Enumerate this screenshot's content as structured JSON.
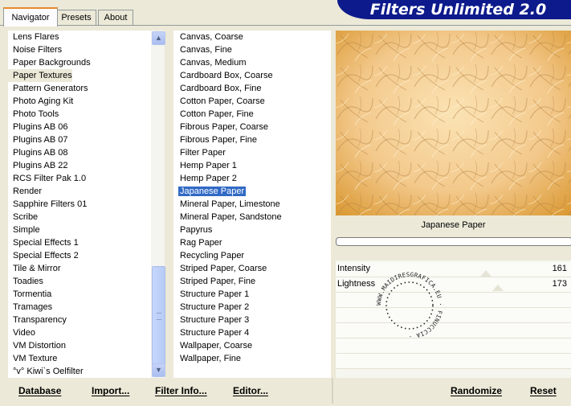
{
  "tabs": [
    {
      "label": "Navigator",
      "active": true
    },
    {
      "label": "Presets",
      "active": false
    },
    {
      "label": "About",
      "active": false
    }
  ],
  "banner_title": "Filters Unlimited 2.0",
  "categories": [
    "Lens Flares",
    "Noise Filters",
    "Paper Backgrounds",
    "Paper Textures",
    "Pattern Generators",
    "Photo Aging Kit",
    "Photo Tools",
    "Plugins AB 06",
    "Plugins AB 07",
    "Plugins AB 08",
    "Plugins AB 22",
    "RCS Filter Pak 1.0",
    "Render",
    "Sapphire Filters 01",
    "Scribe",
    "Simple",
    "Special Effects 1",
    "Special Effects 2",
    "Tile & Mirror",
    "Toadies",
    "Tormentia",
    "Tramages",
    "Transparency",
    "Video",
    "VM Distortion",
    "VM Texture",
    "°v° Kiwi`s Oelfilter"
  ],
  "selected_category": "Paper Textures",
  "filters": [
    "Canvas, Coarse",
    "Canvas, Fine",
    "Canvas, Medium",
    "Cardboard Box, Coarse",
    "Cardboard Box, Fine",
    "Cotton Paper, Coarse",
    "Cotton Paper, Fine",
    "Fibrous Paper, Coarse",
    "Fibrous Paper, Fine",
    "Filter Paper",
    "Hemp Paper 1",
    "Hemp Paper 2",
    "Japanese Paper",
    "Mineral Paper, Limestone",
    "Mineral Paper, Sandstone",
    "Papyrus",
    "Rag Paper",
    "Recycling Paper",
    "Striped Paper, Coarse",
    "Striped Paper, Fine",
    "Structure Paper 1",
    "Structure Paper 2",
    "Structure Paper 3",
    "Structure Paper 4",
    "Wallpaper, Coarse",
    "Wallpaper, Fine"
  ],
  "selected_filter": "Japanese Paper",
  "preview_filter_name": "Japanese Paper",
  "controls": [
    {
      "label": "Intensity",
      "value": "161"
    },
    {
      "label": "Lightness",
      "value": "173"
    }
  ],
  "watermark_text": "WWW.MAIDIRESGRAFICA.EU · FINUCCCIA ·",
  "buttons": {
    "database": "Database",
    "import": "Import...",
    "filter_info": "Filter Info...",
    "editor": "Editor...",
    "randomize": "Randomize",
    "reset": "Reset"
  },
  "colors": {
    "banner": "#0c1a8c",
    "selection": "#316ac5",
    "preview_base": "#f2c88a"
  },
  "icons": {
    "scroll_up": "▲",
    "scroll_down": "▼",
    "scroll_grip": "≡"
  }
}
